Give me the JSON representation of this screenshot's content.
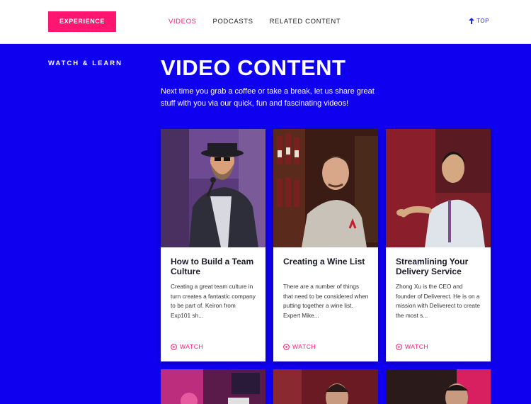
{
  "header": {
    "experience_label": "EXPERIENCE",
    "nav": [
      {
        "label": "VIDEOS",
        "active": true
      },
      {
        "label": "PODCASTS",
        "active": false
      },
      {
        "label": "RELATED CONTENT",
        "active": false
      }
    ],
    "top_label": "TOP"
  },
  "section": {
    "side_label": "WATCH & LEARN",
    "title": "VIDEO CONTENT",
    "intro": "Next time you grab a coffee or take a break, let us share great stuff with you via our quick, fun and fascinating videos!"
  },
  "cards": [
    {
      "title": "How to Build a Team Culture",
      "excerpt": "Creating a great team culture in turn creates a fantastic company to be part of. Keiron from Exp101 sh...",
      "watch_label": "WATCH"
    },
    {
      "title": "Creating a Wine List",
      "excerpt": "There are a number of things that need to be considered when putting together a wine list. Expert Mike...",
      "watch_label": "WATCH"
    },
    {
      "title": "Streamlining Your Delivery Service",
      "excerpt": "Zhong Xu is the CEO and founder of Deliverect. He is on a mission with Deliverect to create the most s...",
      "watch_label": "WATCH"
    }
  ],
  "colors": {
    "brand_blue": "#1000f0",
    "accent_pink": "#ff1670"
  }
}
